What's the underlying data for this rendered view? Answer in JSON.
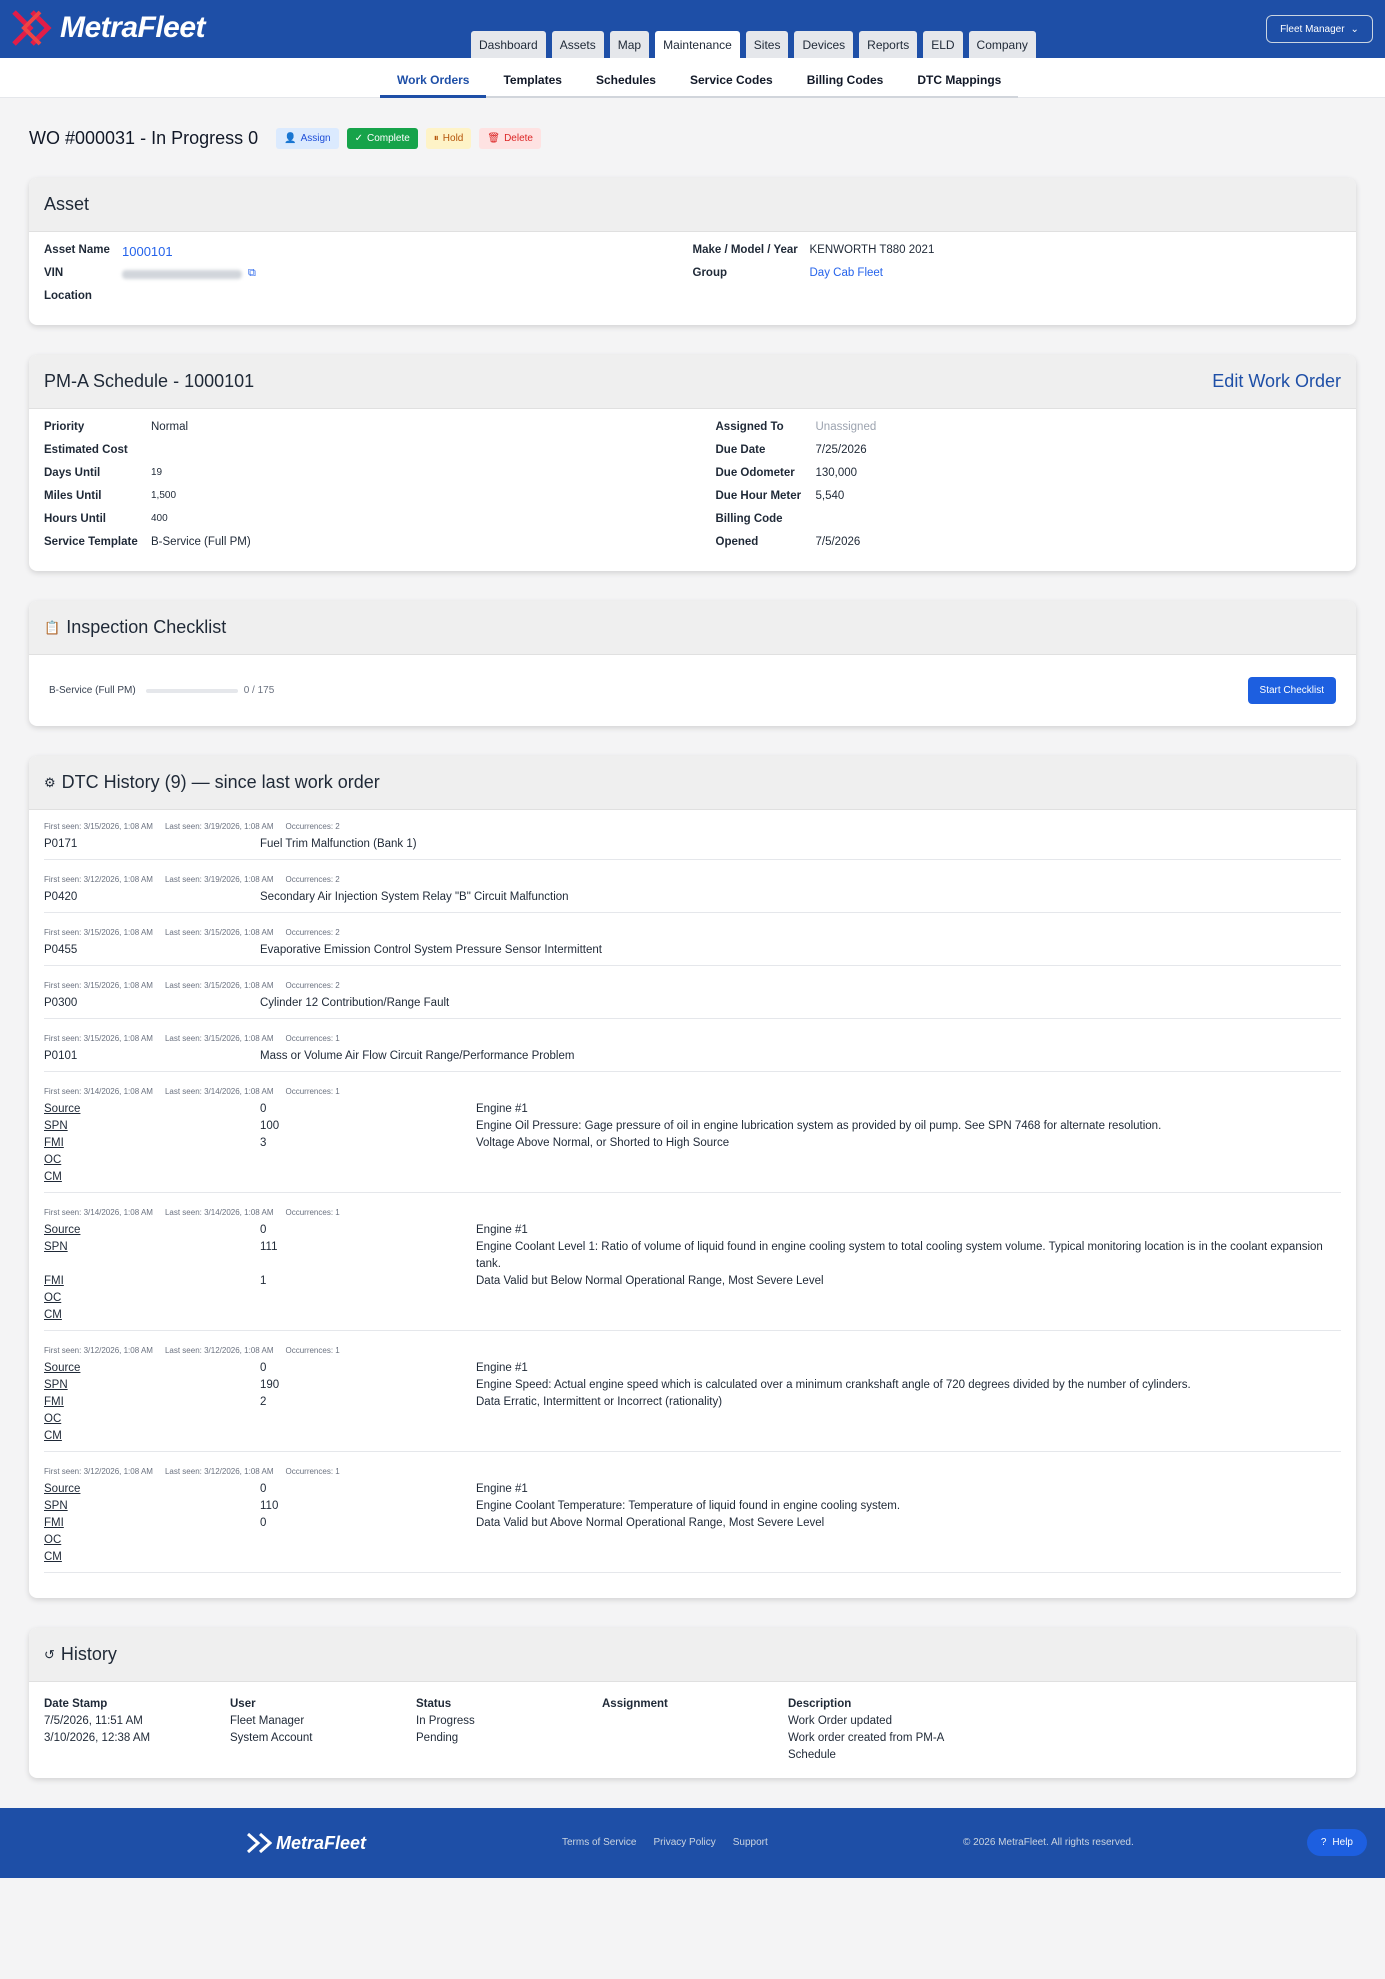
{
  "app": {
    "brand": "MetraFleet"
  },
  "nav": {
    "tabs": [
      "Dashboard",
      "Assets",
      "Map",
      "Maintenance",
      "Sites",
      "Devices",
      "Reports",
      "ELD",
      "Company"
    ],
    "active": "Maintenance",
    "user": "Fleet Manager"
  },
  "subnav": {
    "tabs": [
      "Work Orders",
      "Templates",
      "Schedules",
      "Service Codes",
      "Billing Codes",
      "DTC Mappings"
    ],
    "active": "Work Orders"
  },
  "wo": {
    "title": "WO #000031 - In Progress 0",
    "actions": {
      "assign": "Assign",
      "complete": "Complete",
      "hold": "Hold",
      "delete": "Delete"
    }
  },
  "asset": {
    "heading": "Asset",
    "name_label": "Asset Name",
    "name": "1000101",
    "vin_label": "VIN",
    "location_label": "Location",
    "mmy_label": "Make / Model / Year",
    "mmy": "KENWORTH T880 2021",
    "group_label": "Group",
    "group": "Day Cab Fleet"
  },
  "schedule": {
    "heading": "PM-A Schedule - 1000101",
    "edit": "Edit Work Order",
    "left": [
      {
        "k": "Priority",
        "v": "Normal"
      },
      {
        "k": "Estimated Cost",
        "v": ""
      },
      {
        "k": "Days Until",
        "v": "19"
      },
      {
        "k": "Miles Until",
        "v": "1,500"
      },
      {
        "k": "Hours Until",
        "v": "400"
      },
      {
        "k": "Service Template",
        "v": "B-Service (Full PM)"
      }
    ],
    "right": [
      {
        "k": "Assigned To",
        "v": "Unassigned"
      },
      {
        "k": "Due Date",
        "v": "7/25/2026"
      },
      {
        "k": "Due Odometer",
        "v": "130,000"
      },
      {
        "k": "Due Hour Meter",
        "v": "5,540"
      },
      {
        "k": "Billing Code",
        "v": ""
      },
      {
        "k": "Opened",
        "v": "7/5/2026"
      }
    ]
  },
  "checklist": {
    "heading": "Inspection Checklist",
    "template": "B-Service (Full PM)",
    "progress_text": "0 / 175",
    "progress_fraction": 0,
    "start": "Start Checklist"
  },
  "dtc": {
    "heading": "DTC History (9) — since last work order",
    "items": [
      {
        "first": "First seen: 3/15/2026, 1:08 AM",
        "last": "Last seen: 3/19/2026, 1:08 AM",
        "occ": "Occurrences: 2",
        "code": "P0171",
        "desc": "Fuel Trim Malfunction (Bank 1)"
      },
      {
        "first": "First seen: 3/12/2026, 1:08 AM",
        "last": "Last seen: 3/19/2026, 1:08 AM",
        "occ": "Occurrences: 2",
        "code": "P0420",
        "desc": "Secondary Air Injection System Relay \"B\" Circuit Malfunction"
      },
      {
        "first": "First seen: 3/15/2026, 1:08 AM",
        "last": "Last seen: 3/15/2026, 1:08 AM",
        "occ": "Occurrences: 2",
        "code": "P0455",
        "desc": "Evaporative Emission Control System Pressure Sensor Intermittent"
      },
      {
        "first": "First seen: 3/15/2026, 1:08 AM",
        "last": "Last seen: 3/15/2026, 1:08 AM",
        "occ": "Occurrences: 2",
        "code": "P0300",
        "desc": "Cylinder 12 Contribution/Range Fault"
      },
      {
        "first": "First seen: 3/15/2026, 1:08 AM",
        "last": "Last seen: 3/15/2026, 1:08 AM",
        "occ": "Occurrences: 1",
        "code": "P0101",
        "desc": "Mass or Volume Air Flow Circuit Range/Performance Problem"
      }
    ],
    "j1939": [
      {
        "first": "First seen: 3/14/2026, 1:08 AM",
        "last": "Last seen: 3/14/2026, 1:08 AM",
        "occ": "Occurrences: 1",
        "rows": [
          [
            "Source",
            "0",
            "Engine #1"
          ],
          [
            "SPN",
            "100",
            "Engine Oil Pressure: Gage pressure of oil in engine lubrication system as provided by oil pump. See SPN 7468 for alternate resolution."
          ],
          [
            "FMI",
            "3",
            "Voltage Above Normal, or Shorted to High Source"
          ],
          [
            "OC",
            "",
            ""
          ],
          [
            "CM",
            "",
            ""
          ]
        ]
      },
      {
        "first": "First seen: 3/14/2026, 1:08 AM",
        "last": "Last seen: 3/14/2026, 1:08 AM",
        "occ": "Occurrences: 1",
        "rows": [
          [
            "Source",
            "0",
            "Engine #1"
          ],
          [
            "SPN",
            "111",
            "Engine Coolant Level 1: Ratio of volume of liquid found in engine cooling system to total cooling system volume. Typical monitoring location is in the coolant expansion tank."
          ],
          [
            "FMI",
            "1",
            "Data Valid but Below Normal Operational Range, Most Severe Level"
          ],
          [
            "OC",
            "",
            ""
          ],
          [
            "CM",
            "",
            ""
          ]
        ]
      },
      {
        "first": "First seen: 3/12/2026, 1:08 AM",
        "last": "Last seen: 3/12/2026, 1:08 AM",
        "occ": "Occurrences: 1",
        "rows": [
          [
            "Source",
            "0",
            "Engine #1"
          ],
          [
            "SPN",
            "190",
            "Engine Speed: Actual engine speed which is calculated over a minimum crankshaft angle of 720 degrees divided by the number of cylinders."
          ],
          [
            "FMI",
            "2",
            "Data Erratic, Intermittent or Incorrect (rationality)"
          ],
          [
            "OC",
            "",
            ""
          ],
          [
            "CM",
            "",
            ""
          ]
        ]
      },
      {
        "first": "First seen: 3/12/2026, 1:08 AM",
        "last": "Last seen: 3/12/2026, 1:08 AM",
        "occ": "Occurrences: 1",
        "rows": [
          [
            "Source",
            "0",
            "Engine #1"
          ],
          [
            "SPN",
            "110",
            "Engine Coolant Temperature: Temperature of liquid found in engine cooling system."
          ],
          [
            "FMI",
            "0",
            "Data Valid but Above Normal Operational Range, Most Severe Level"
          ],
          [
            "OC",
            "",
            ""
          ],
          [
            "CM",
            "",
            ""
          ]
        ]
      }
    ]
  },
  "history": {
    "heading": "History",
    "columns": [
      "Date Stamp",
      "User",
      "Status",
      "Assignment",
      "Description"
    ],
    "rows": [
      [
        "7/5/2026, 11:51 AM",
        "Fleet Manager",
        "In Progress",
        "",
        "Work Order updated"
      ],
      [
        "3/10/2026, 12:38 AM",
        "System Account",
        "Pending",
        "",
        "Work order created from PM-A Schedule"
      ]
    ]
  },
  "footer": {
    "brand": "MetraFleet",
    "links": [
      "Terms of Service",
      "Privacy Policy",
      "Support"
    ],
    "copy": "© 2026 MetraFleet. All rights reserved.",
    "help": "Help"
  },
  "colors": {
    "brand": "#1e4fa7",
    "complete": "#16a34a",
    "link": "#2563eb"
  }
}
